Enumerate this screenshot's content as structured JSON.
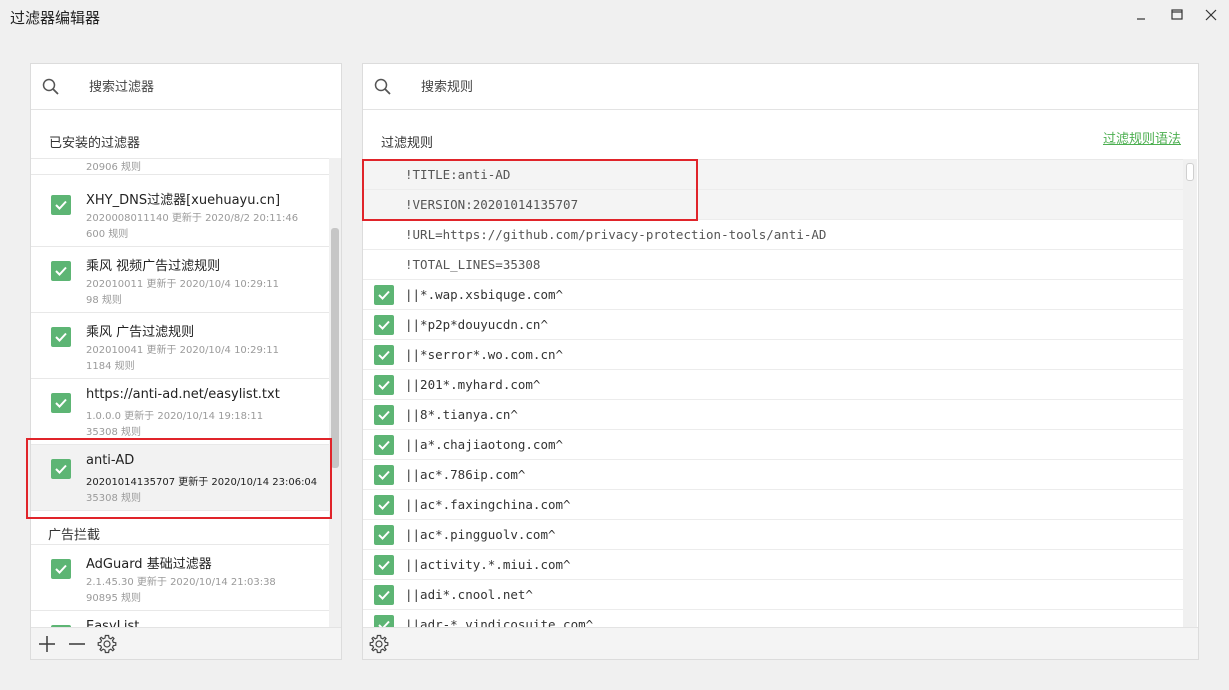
{
  "window": {
    "title": "过滤器编辑器"
  },
  "left_panel": {
    "search_placeholder": "搜索过滤器",
    "installed_header": "已安装的过滤器",
    "top_partial_count": "20906 规则",
    "filters": [
      {
        "name": "XHY_DNS过滤器[xuehuayu.cn]",
        "meta": "2020008011140 更新于 2020/8/2 20:11:46",
        "count": "600 规则",
        "checked": true
      },
      {
        "name": "乘风 视频广告过滤规则",
        "meta": "202010011 更新于 2020/10/4 10:29:11",
        "count": "98 规则",
        "checked": true
      },
      {
        "name": "乘风 广告过滤规则",
        "meta": "202010041 更新于 2020/10/4 10:29:11",
        "count": "1184 规则",
        "checked": true
      },
      {
        "name": "https://anti-ad.net/easylist.txt",
        "meta": "1.0.0.0 更新于 2020/10/14 19:18:11",
        "count": "35308 规则",
        "checked": true
      },
      {
        "name": "anti-AD",
        "meta": "20201014135707 更新于 2020/10/14 23:06:04",
        "count": "35308 规则",
        "checked": true,
        "selected": true
      }
    ],
    "group_label": "广告拦截",
    "group_filters": [
      {
        "name": "AdGuard 基础过滤器",
        "meta": "2.1.45.30 更新于 2020/10/14 21:03:38",
        "count": "90895 规则",
        "checked": true
      },
      {
        "name": "EasyList",
        "checked": true
      }
    ],
    "bottom_buttons": [
      "add-icon",
      "remove-icon",
      "gear-icon"
    ]
  },
  "right_panel": {
    "search_placeholder": "搜索规则",
    "header": "过滤规则",
    "syntax_link": "过滤规则语法",
    "rules": [
      {
        "text": "!TITLE:anti-AD",
        "comment": true
      },
      {
        "text": "!VERSION:20201014135707",
        "comment": true
      },
      {
        "text": "!URL=https://github.com/privacy-protection-tools/anti-AD",
        "comment": true
      },
      {
        "text": "!TOTAL_LINES=35308",
        "comment": true
      },
      {
        "text": "||*.wap.xsbiquge.com^",
        "checked": true
      },
      {
        "text": "||*p2p*douyucdn.cn^",
        "checked": true
      },
      {
        "text": "||*serror*.wo.com.cn^",
        "checked": true
      },
      {
        "text": "||201*.myhard.com^",
        "checked": true
      },
      {
        "text": "||8*.tianya.cn^",
        "checked": true
      },
      {
        "text": "||a*.chajiaotong.com^",
        "checked": true
      },
      {
        "text": "||ac*.786ip.com^",
        "checked": true
      },
      {
        "text": "||ac*.faxingchina.com^",
        "checked": true
      },
      {
        "text": "||ac*.pingguolv.com^",
        "checked": true
      },
      {
        "text": "||activity.*.miui.com^",
        "checked": true
      },
      {
        "text": "||adi*.cnool.net^",
        "checked": true
      },
      {
        "text": "||adr-*.vindicosuite.com^",
        "checked": true
      }
    ]
  },
  "colors": {
    "check_green": "#5db574",
    "link_green": "#4caf50",
    "highlight_red": "#e0242a"
  }
}
